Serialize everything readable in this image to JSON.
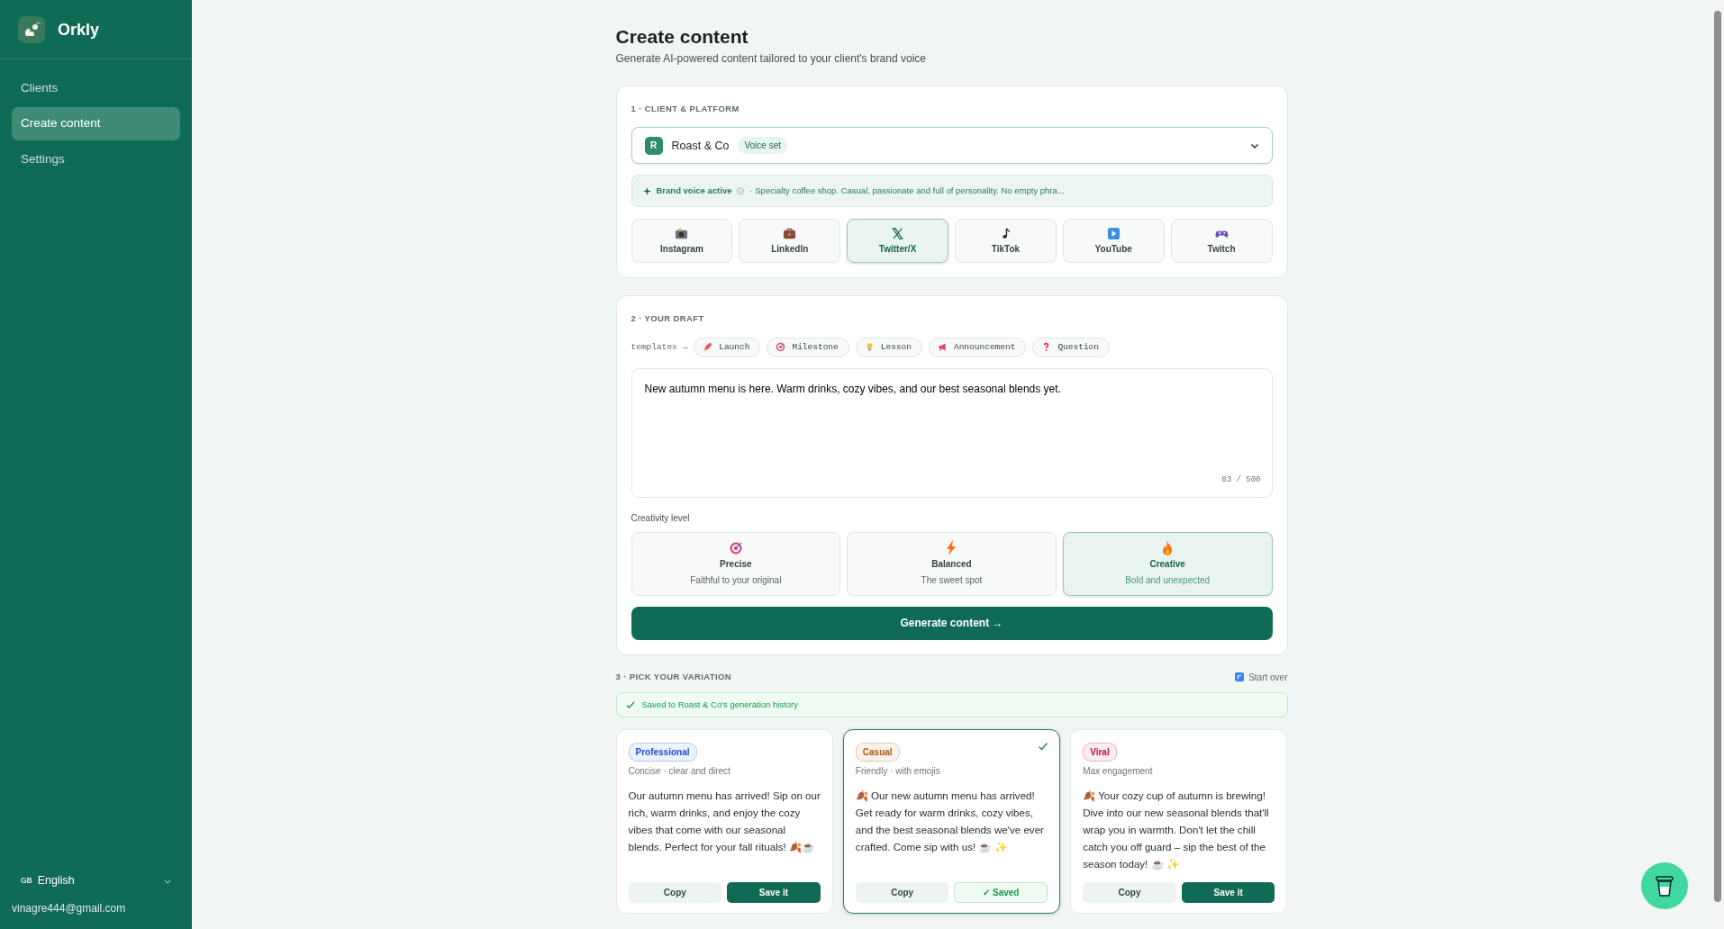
{
  "sidebar": {
    "brand": "Orkly",
    "nav": [
      {
        "label": "Clients",
        "selected": false
      },
      {
        "label": "Create content",
        "selected": true
      },
      {
        "label": "Settings",
        "selected": false
      }
    ],
    "language": {
      "flag": "GB",
      "label": "English"
    },
    "email": "vinagre444@gmail.com"
  },
  "header": {
    "title": "Create content",
    "subtitle": "Generate AI-powered content tailored to your client's brand voice"
  },
  "client_section": {
    "heading": "1 · CLIENT & PLATFORM",
    "client": {
      "initial": "R",
      "name": "Roast & Co",
      "badge": "Voice set"
    },
    "brand_voice": {
      "label": "Brand voice active",
      "text": "· Specialty coffee shop. Casual, passionate and full of personality. No empty phra..."
    },
    "platforms": [
      {
        "label": "Instagram",
        "selected": false
      },
      {
        "label": "LinkedIn",
        "selected": false
      },
      {
        "label": "Twitter/X",
        "selected": true
      },
      {
        "label": "TikTok",
        "selected": false
      },
      {
        "label": "YouTube",
        "selected": false
      },
      {
        "label": "Twitch",
        "selected": false
      }
    ]
  },
  "draft_section": {
    "heading": "2 · YOUR DRAFT",
    "templates_label": "templates →",
    "templates": [
      "Launch",
      "Milestone",
      "Lesson",
      "Announcement",
      "Question"
    ],
    "draft": "New autumn menu is here. Warm drinks, cozy vibes, and our best seasonal blends yet.",
    "counter": "83 / 500",
    "creativity_label": "Creativity level",
    "creativity": [
      {
        "title": "Precise",
        "subtitle": "Faithful to your original",
        "selected": false
      },
      {
        "title": "Balanced",
        "subtitle": "The sweet spot",
        "selected": false
      },
      {
        "title": "Creative",
        "subtitle": "Bold and unexpected",
        "selected": true
      }
    ],
    "generate_button": "Generate content →"
  },
  "variation_section": {
    "heading": "3 · PICK YOUR VARIATION",
    "start_over": "Start over",
    "saved_notice": "Saved to Roast & Co's generation history",
    "variations": [
      {
        "tag": "Professional",
        "color": "#1d4ed8",
        "subtitle": "Concise · clear and direct",
        "text": "Our autumn menu has arrived! Sip on our rich, warm drinks, and enjoy the cozy vibes that come with our seasonal blends. Perfect for your fall rituals! 🍂☕",
        "selected": false,
        "saved": false,
        "copy_label": "Copy",
        "save_label": "Save it"
      },
      {
        "tag": "Casual",
        "color": "#b45309",
        "subtitle": "Friendly · with emojis",
        "text": "🍂 Our new autumn menu has arrived! Get ready for warm drinks, cozy vibes, and the best seasonal blends we've ever crafted. Come sip with us! ☕ ✨",
        "selected": true,
        "saved": true,
        "copy_label": "Copy",
        "save_label": "✓ Saved"
      },
      {
        "tag": "Viral",
        "color": "#be123c",
        "subtitle": "Max engagement",
        "text": "🍂 Your cozy cup of autumn is brewing! Dive into our new seasonal blends that'll wrap you in warmth. Don't let the chill catch you off guard – sip the best of the season today! ☕ ✨",
        "selected": false,
        "saved": false,
        "copy_label": "Copy",
        "save_label": "Save it"
      }
    ]
  }
}
